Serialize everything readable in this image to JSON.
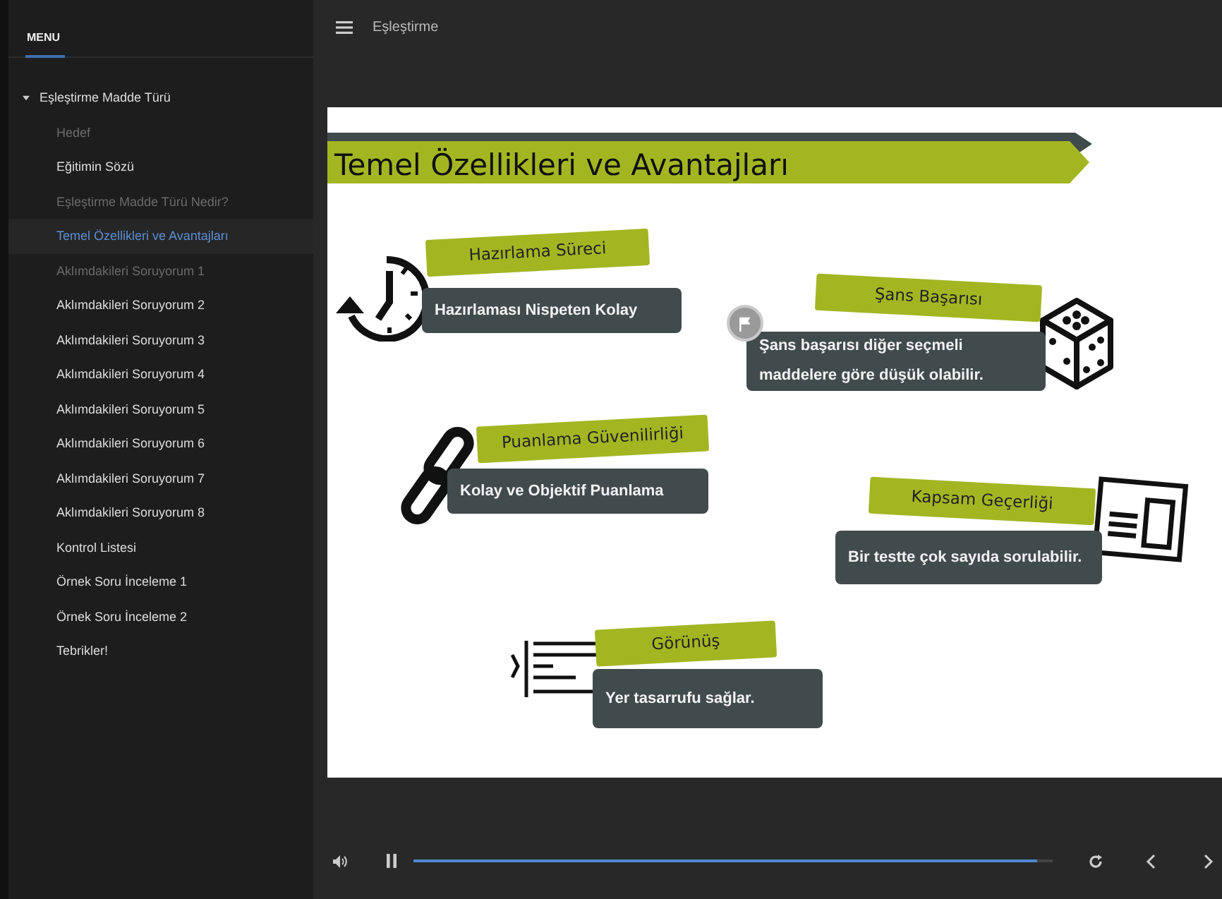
{
  "sidebar": {
    "heading": "MENU",
    "items": [
      {
        "label": "Eşleştirme Madde Türü",
        "expanded": true,
        "children": [
          {
            "label": "Hedef",
            "dimmed": true,
            "selected": false
          },
          {
            "label": "Eğitimin Sözü",
            "dimmed": false,
            "selected": false
          },
          {
            "label": "Eşleştirme Madde Türü Nedir?",
            "dimmed": true,
            "selected": false
          },
          {
            "label": "Temel Özellikleri ve Avantajları",
            "dimmed": false,
            "selected": true
          },
          {
            "label": "Aklımdakileri Soruyorum 1",
            "dimmed": true,
            "selected": false
          },
          {
            "label": "Aklımdakileri Soruyorum 2",
            "dimmed": false,
            "selected": false
          },
          {
            "label": "Aklımdakileri Soruyorum 3",
            "dimmed": false,
            "selected": false
          },
          {
            "label": "Aklımdakileri Soruyorum 4",
            "dimmed": false,
            "selected": false
          },
          {
            "label": "Aklımdakileri Soruyorum 5",
            "dimmed": false,
            "selected": false
          },
          {
            "label": "Aklımdakileri Soruyorum 6",
            "dimmed": false,
            "selected": false
          },
          {
            "label": "Aklımdakileri Soruyorum 7",
            "dimmed": false,
            "selected": false
          },
          {
            "label": "Aklımdakileri Soruyorum 8",
            "dimmed": false,
            "selected": false
          },
          {
            "label": "Kontrol Listesi",
            "dimmed": false,
            "selected": false
          },
          {
            "label": "Örnek Soru İnceleme 1",
            "dimmed": false,
            "selected": false
          },
          {
            "label": "Örnek Soru İnceleme 2",
            "dimmed": false,
            "selected": false
          },
          {
            "label": "Tebrikler!",
            "dimmed": false,
            "selected": false
          }
        ]
      }
    ]
  },
  "header": {
    "title": "Eşleştirme"
  },
  "slide": {
    "title": "Temel Özellikleri ve Avantajları",
    "features": [
      {
        "label": "Hazırlama Süreci",
        "text": "Hazırlaması Nispeten Kolay"
      },
      {
        "label": "Şans Başarısı",
        "text": "Şans başarısı diğer seçmeli maddelere göre düşük olabilir.",
        "flag": true
      },
      {
        "label": "Puanlama Güvenilirliği",
        "text": "Kolay ve Objektif Puanlama"
      },
      {
        "label": "Kapsam Geçerliği",
        "text": "Bir testte çok sayıda sorulabilir."
      },
      {
        "label": "Görünüş",
        "text": "Yer tasarrufu sağlar."
      }
    ]
  },
  "player": {
    "level": 0.976
  }
}
